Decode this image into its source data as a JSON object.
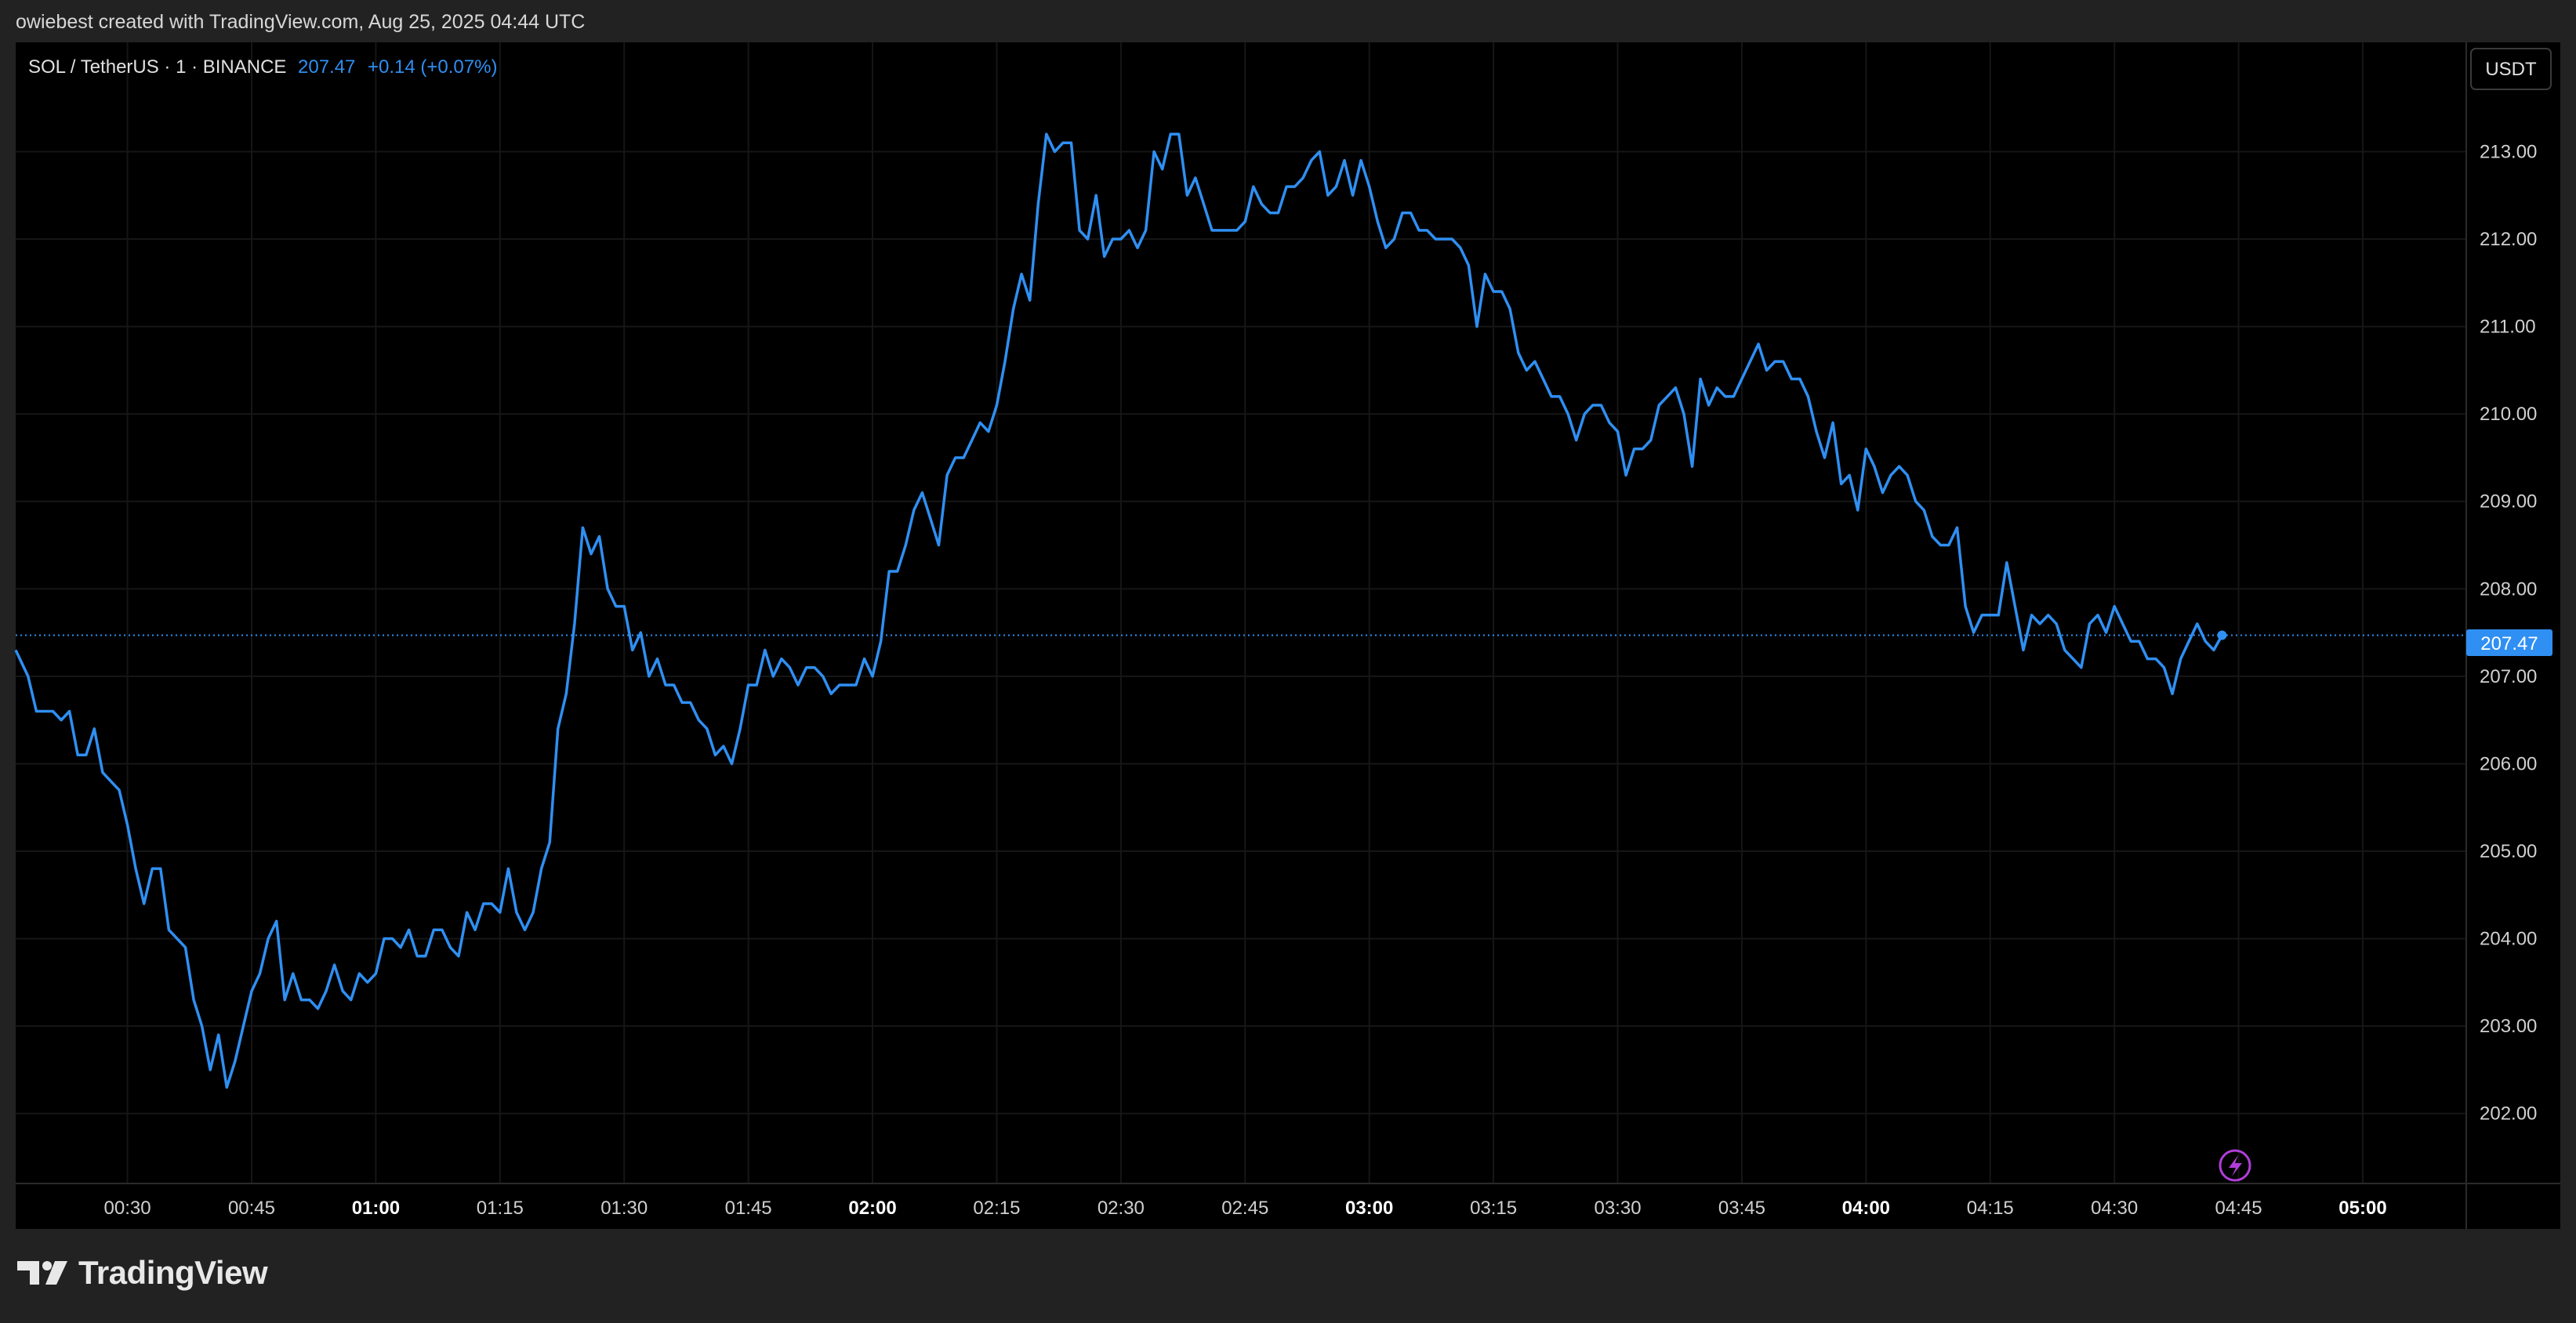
{
  "header": {
    "attribution": "owiebest created with TradingView.com, Aug 25, 2025 04:44 UTC"
  },
  "legend": {
    "symbol": "SOL / TetherUS · 1 · BINANCE",
    "last_price": "207.47",
    "change": "+0.14 (+0.07%)"
  },
  "currency_button": "USDT",
  "last_price_label": "207.47",
  "brand": {
    "name": "TradingView"
  },
  "icons": {
    "alert": "lightning-bolt-icon",
    "logo": "tradingview-logo-icon"
  },
  "colors": {
    "line": "#2f8ff2",
    "price_tag": "#2f8ff2",
    "alert": "#b03ed8",
    "background": "#000000",
    "frame": "#222222"
  },
  "chart_data": {
    "type": "line",
    "x_unit": "minutes after 00:00 UTC, Aug 25 2025",
    "y_ticks": [
      "202.00",
      "203.00",
      "204.00",
      "205.00",
      "206.00",
      "207.00",
      "208.00",
      "209.00",
      "210.00",
      "211.00",
      "212.00",
      "213.00"
    ],
    "ylim": [
      201.2,
      214.25
    ],
    "xlim": [
      16.5,
      312.5
    ],
    "x_ticks": [
      {
        "label": "00:30",
        "bold": false
      },
      {
        "label": "00:45",
        "bold": false
      },
      {
        "label": "01:00",
        "bold": true
      },
      {
        "label": "01:15",
        "bold": false
      },
      {
        "label": "01:30",
        "bold": false
      },
      {
        "label": "01:45",
        "bold": false
      },
      {
        "label": "02:00",
        "bold": true
      },
      {
        "label": "02:15",
        "bold": false
      },
      {
        "label": "02:30",
        "bold": false
      },
      {
        "label": "02:45",
        "bold": false
      },
      {
        "label": "03:00",
        "bold": true
      },
      {
        "label": "03:15",
        "bold": false
      },
      {
        "label": "03:30",
        "bold": false
      },
      {
        "label": "03:45",
        "bold": false
      },
      {
        "label": "04:00",
        "bold": true
      },
      {
        "label": "04:15",
        "bold": false
      },
      {
        "label": "04:30",
        "bold": false
      },
      {
        "label": "04:45",
        "bold": false
      },
      {
        "label": "05:00",
        "bold": true
      }
    ],
    "x_tick_values": [
      30,
      45,
      60,
      75,
      90,
      105,
      120,
      135,
      150,
      165,
      180,
      195,
      210,
      225,
      240,
      255,
      270,
      285,
      300
    ],
    "last_price": 207.47,
    "series": [
      {
        "points": [
          [
            16.5,
            207.3
          ],
          [
            18,
            207.0
          ],
          [
            19,
            206.6
          ],
          [
            21,
            206.6
          ],
          [
            22,
            206.5
          ],
          [
            23,
            206.6
          ],
          [
            24,
            206.1
          ],
          [
            25,
            206.1
          ],
          [
            26,
            206.4
          ],
          [
            27,
            205.9
          ],
          [
            28,
            205.8
          ],
          [
            29,
            205.7
          ],
          [
            30,
            205.3
          ],
          [
            31,
            204.8
          ],
          [
            32,
            204.4
          ],
          [
            33,
            204.8
          ],
          [
            34,
            204.8
          ],
          [
            35,
            204.1
          ],
          [
            36,
            204.0
          ],
          [
            37,
            203.9
          ],
          [
            38,
            203.3
          ],
          [
            39,
            203.0
          ],
          [
            40,
            202.5
          ],
          [
            41,
            202.9
          ],
          [
            42,
            202.3
          ],
          [
            43,
            202.6
          ],
          [
            44,
            203.0
          ],
          [
            45,
            203.4
          ],
          [
            46,
            203.6
          ],
          [
            47,
            204.0
          ],
          [
            48,
            204.2
          ],
          [
            49,
            203.3
          ],
          [
            50,
            203.6
          ],
          [
            51,
            203.3
          ],
          [
            52,
            203.3
          ],
          [
            53,
            203.2
          ],
          [
            54,
            203.4
          ],
          [
            55,
            203.7
          ],
          [
            56,
            203.4
          ],
          [
            57,
            203.3
          ],
          [
            58,
            203.6
          ],
          [
            59,
            203.5
          ],
          [
            60,
            203.6
          ],
          [
            61,
            204.0
          ],
          [
            62,
            204.0
          ],
          [
            63,
            203.9
          ],
          [
            64,
            204.1
          ],
          [
            65,
            203.8
          ],
          [
            66,
            203.8
          ],
          [
            67,
            204.1
          ],
          [
            68,
            204.1
          ],
          [
            69,
            203.9
          ],
          [
            70,
            203.8
          ],
          [
            71,
            204.3
          ],
          [
            72,
            204.1
          ],
          [
            73,
            204.4
          ],
          [
            74,
            204.4
          ],
          [
            75,
            204.3
          ],
          [
            76,
            204.8
          ],
          [
            77,
            204.3
          ],
          [
            78,
            204.1
          ],
          [
            79,
            204.3
          ],
          [
            80,
            204.8
          ],
          [
            81,
            205.1
          ],
          [
            82,
            206.4
          ],
          [
            83,
            206.8
          ],
          [
            84,
            207.6
          ],
          [
            85,
            208.7
          ],
          [
            86,
            208.4
          ],
          [
            87,
            208.6
          ],
          [
            88,
            208.0
          ],
          [
            89,
            207.8
          ],
          [
            90,
            207.8
          ],
          [
            91,
            207.3
          ],
          [
            92,
            207.5
          ],
          [
            93,
            207.0
          ],
          [
            94,
            207.2
          ],
          [
            95,
            206.9
          ],
          [
            96,
            206.9
          ],
          [
            97,
            206.7
          ],
          [
            98,
            206.7
          ],
          [
            99,
            206.5
          ],
          [
            100,
            206.4
          ],
          [
            101,
            206.1
          ],
          [
            102,
            206.2
          ],
          [
            103,
            206.0
          ],
          [
            104,
            206.4
          ],
          [
            105,
            206.9
          ],
          [
            106,
            206.9
          ],
          [
            107,
            207.3
          ],
          [
            108,
            207.0
          ],
          [
            109,
            207.2
          ],
          [
            110,
            207.1
          ],
          [
            111,
            206.9
          ],
          [
            112,
            207.1
          ],
          [
            113,
            207.1
          ],
          [
            114,
            207.0
          ],
          [
            115,
            206.8
          ],
          [
            116,
            206.9
          ],
          [
            117,
            206.9
          ],
          [
            118,
            206.9
          ],
          [
            119,
            207.2
          ],
          [
            120,
            207.0
          ],
          [
            121,
            207.4
          ],
          [
            122,
            208.2
          ],
          [
            123,
            208.2
          ],
          [
            124,
            208.5
          ],
          [
            125,
            208.9
          ],
          [
            126,
            209.1
          ],
          [
            127,
            208.8
          ],
          [
            128,
            208.5
          ],
          [
            129,
            209.3
          ],
          [
            130,
            209.5
          ],
          [
            131,
            209.5
          ],
          [
            132,
            209.7
          ],
          [
            133,
            209.9
          ],
          [
            134,
            209.8
          ],
          [
            135,
            210.1
          ],
          [
            136,
            210.6
          ],
          [
            137,
            211.2
          ],
          [
            138,
            211.6
          ],
          [
            139,
            211.3
          ],
          [
            140,
            212.4
          ],
          [
            141,
            213.2
          ],
          [
            142,
            213.0
          ],
          [
            143,
            213.1
          ],
          [
            144,
            213.1
          ],
          [
            145,
            212.1
          ],
          [
            146,
            212.0
          ],
          [
            147,
            212.5
          ],
          [
            148,
            211.8
          ],
          [
            149,
            212.0
          ],
          [
            150,
            212.0
          ],
          [
            151,
            212.1
          ],
          [
            152,
            211.9
          ],
          [
            153,
            212.1
          ],
          [
            154,
            213.0
          ],
          [
            155,
            212.8
          ],
          [
            156,
            213.2
          ],
          [
            157,
            213.2
          ],
          [
            158,
            212.5
          ],
          [
            159,
            212.7
          ],
          [
            160,
            212.4
          ],
          [
            161,
            212.1
          ],
          [
            162,
            212.1
          ],
          [
            163,
            212.1
          ],
          [
            164,
            212.1
          ],
          [
            165,
            212.2
          ],
          [
            166,
            212.6
          ],
          [
            167,
            212.4
          ],
          [
            168,
            212.3
          ],
          [
            169,
            212.3
          ],
          [
            170,
            212.6
          ],
          [
            171,
            212.6
          ],
          [
            172,
            212.7
          ],
          [
            173,
            212.9
          ],
          [
            174,
            213.0
          ],
          [
            175,
            212.5
          ],
          [
            176,
            212.6
          ],
          [
            177,
            212.9
          ],
          [
            178,
            212.5
          ],
          [
            179,
            212.9
          ],
          [
            180,
            212.6
          ],
          [
            181,
            212.2
          ],
          [
            182,
            211.9
          ],
          [
            183,
            212.0
          ],
          [
            184,
            212.3
          ],
          [
            185,
            212.3
          ],
          [
            186,
            212.1
          ],
          [
            187,
            212.1
          ],
          [
            188,
            212.0
          ],
          [
            189,
            212.0
          ],
          [
            190,
            212.0
          ],
          [
            191,
            211.9
          ],
          [
            192,
            211.7
          ],
          [
            193,
            211.0
          ],
          [
            194,
            211.6
          ],
          [
            195,
            211.4
          ],
          [
            196,
            211.4
          ],
          [
            197,
            211.2
          ],
          [
            198,
            210.7
          ],
          [
            199,
            210.5
          ],
          [
            200,
            210.6
          ],
          [
            201,
            210.4
          ],
          [
            202,
            210.2
          ],
          [
            203,
            210.2
          ],
          [
            204,
            210.0
          ],
          [
            205,
            209.7
          ],
          [
            206,
            210.0
          ],
          [
            207,
            210.1
          ],
          [
            208,
            210.1
          ],
          [
            209,
            209.9
          ],
          [
            210,
            209.8
          ],
          [
            211,
            209.3
          ],
          [
            212,
            209.6
          ],
          [
            213,
            209.6
          ],
          [
            214,
            209.7
          ],
          [
            215,
            210.1
          ],
          [
            216,
            210.2
          ],
          [
            217,
            210.3
          ],
          [
            218,
            210.0
          ],
          [
            219,
            209.4
          ],
          [
            220,
            210.4
          ],
          [
            221,
            210.1
          ],
          [
            222,
            210.3
          ],
          [
            223,
            210.2
          ],
          [
            224,
            210.2
          ],
          [
            225,
            210.4
          ],
          [
            226,
            210.6
          ],
          [
            227,
            210.8
          ],
          [
            228,
            210.5
          ],
          [
            229,
            210.6
          ],
          [
            230,
            210.6
          ],
          [
            231,
            210.4
          ],
          [
            232,
            210.4
          ],
          [
            233,
            210.2
          ],
          [
            234,
            209.8
          ],
          [
            235,
            209.5
          ],
          [
            236,
            209.9
          ],
          [
            237,
            209.2
          ],
          [
            238,
            209.3
          ],
          [
            239,
            208.9
          ],
          [
            240,
            209.6
          ],
          [
            241,
            209.4
          ],
          [
            242,
            209.1
          ],
          [
            243,
            209.3
          ],
          [
            244,
            209.4
          ],
          [
            245,
            209.3
          ],
          [
            246,
            209.0
          ],
          [
            247,
            208.9
          ],
          [
            248,
            208.6
          ],
          [
            249,
            208.5
          ],
          [
            250,
            208.5
          ],
          [
            251,
            208.7
          ],
          [
            252,
            207.8
          ],
          [
            253,
            207.5
          ],
          [
            254,
            207.7
          ],
          [
            255,
            207.7
          ],
          [
            256,
            207.7
          ],
          [
            257,
            208.3
          ],
          [
            258,
            207.8
          ],
          [
            259,
            207.3
          ],
          [
            260,
            207.7
          ],
          [
            261,
            207.6
          ],
          [
            262,
            207.7
          ],
          [
            263,
            207.6
          ],
          [
            264,
            207.3
          ],
          [
            265,
            207.2
          ],
          [
            266,
            207.1
          ],
          [
            267,
            207.6
          ],
          [
            268,
            207.7
          ],
          [
            269,
            207.5
          ],
          [
            270,
            207.8
          ],
          [
            271,
            207.6
          ],
          [
            272,
            207.4
          ],
          [
            273,
            207.4
          ],
          [
            274,
            207.2
          ],
          [
            275,
            207.2
          ],
          [
            276,
            207.1
          ],
          [
            277,
            206.8
          ],
          [
            278,
            207.2
          ],
          [
            279,
            207.4
          ],
          [
            280,
            207.6
          ],
          [
            281,
            207.4
          ],
          [
            282,
            207.3
          ],
          [
            283,
            207.47
          ]
        ]
      }
    ]
  }
}
